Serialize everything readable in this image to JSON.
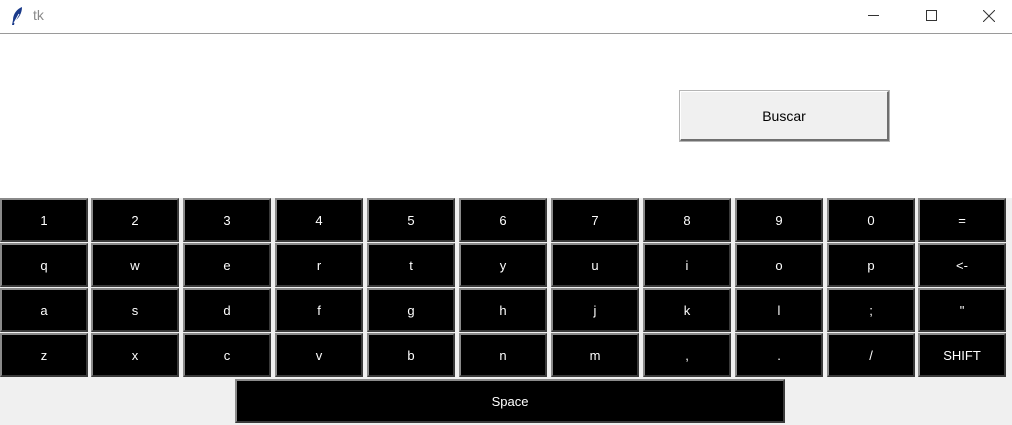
{
  "window": {
    "title": "tk",
    "minimize_icon": "minimize-icon",
    "maximize_icon": "maximize-icon",
    "close_icon": "close-icon",
    "app_icon": "feather-icon"
  },
  "search": {
    "button_label": "Buscar"
  },
  "keyboard": {
    "rows": [
      [
        "1",
        "2",
        "3",
        "4",
        "5",
        "6",
        "7",
        "8",
        "9",
        "0",
        "="
      ],
      [
        "q",
        "w",
        "e",
        "r",
        "t",
        "y",
        "u",
        "i",
        "o",
        "p",
        "<-"
      ],
      [
        "a",
        "s",
        "d",
        "f",
        "g",
        "h",
        "j",
        "k",
        "l",
        ";",
        "\""
      ],
      [
        "z",
        "x",
        "c",
        "v",
        "b",
        "n",
        "m",
        ",",
        ".",
        "/",
        "SHIFT"
      ]
    ],
    "space_label": "Space"
  }
}
